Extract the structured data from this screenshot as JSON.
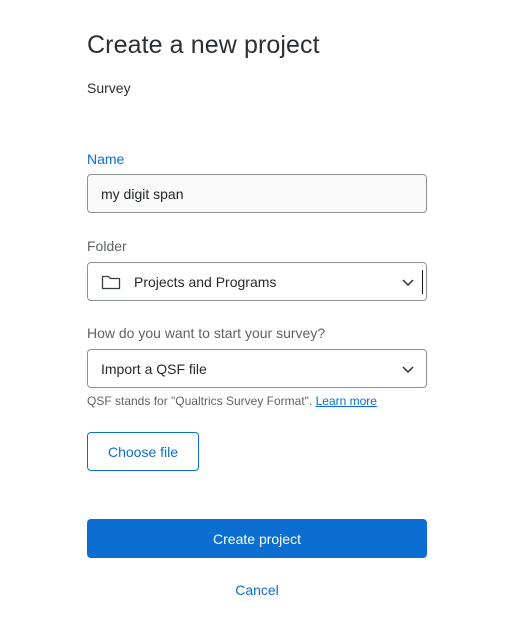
{
  "dialog": {
    "title": "Create a new project",
    "subtitle": "Survey"
  },
  "name_field": {
    "label": "Name",
    "value": "my digit span"
  },
  "folder_field": {
    "label": "Folder",
    "value": "Projects and Programs",
    "icon": "folder-icon"
  },
  "start_field": {
    "label": "How do you want to start your survey?",
    "value": "Import a QSF file"
  },
  "hint": {
    "text": "QSF stands for \"Qualtrics Survey Format\".",
    "link": "Learn more"
  },
  "buttons": {
    "choose_file": "Choose file",
    "create_project": "Create project",
    "cancel": "Cancel"
  },
  "colors": {
    "accent": "#0b6ed0",
    "border": "#8c9196"
  }
}
